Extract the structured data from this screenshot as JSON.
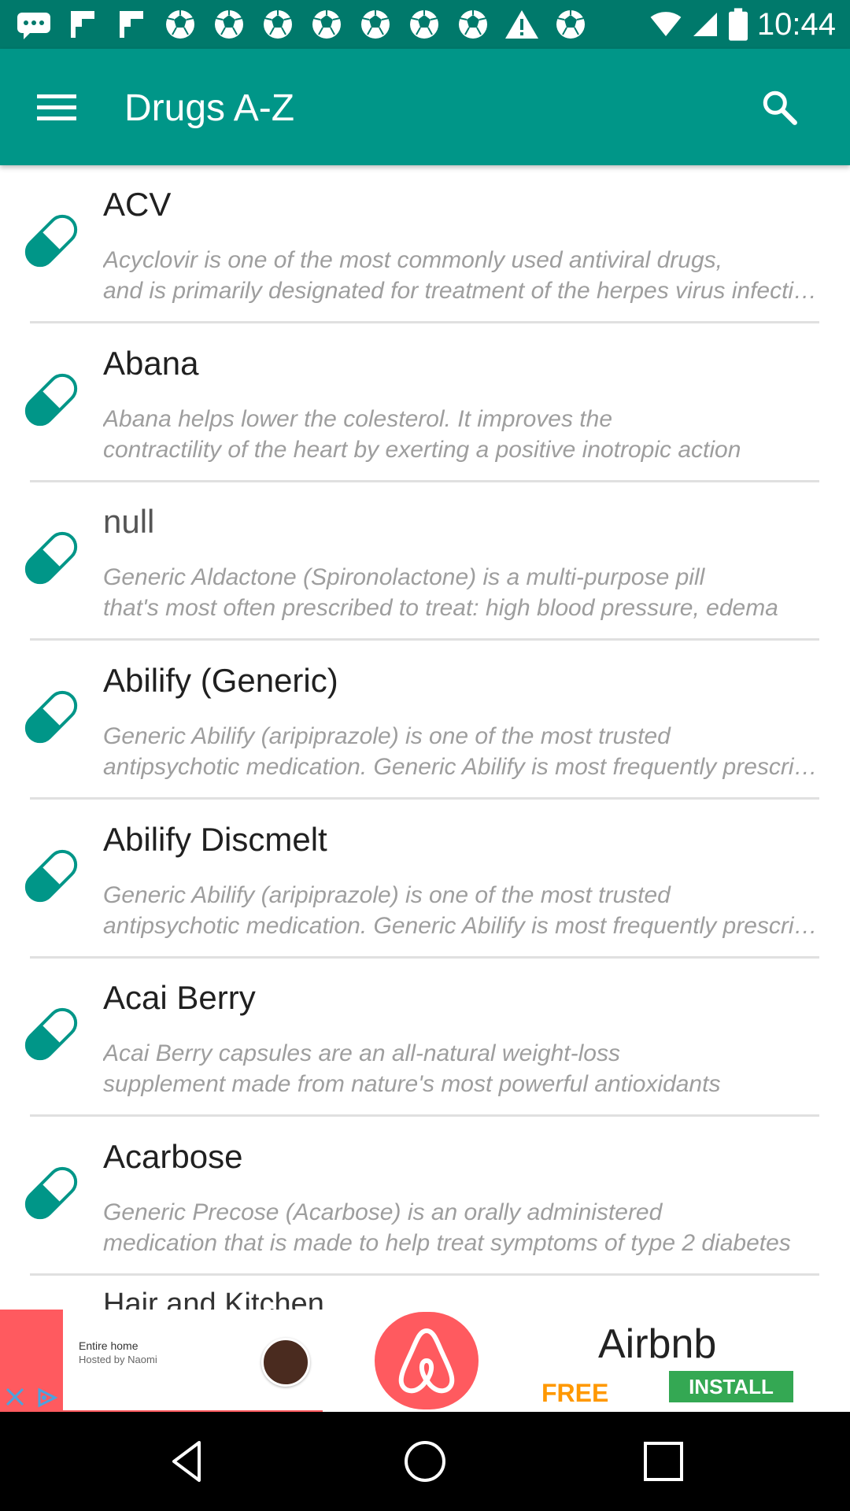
{
  "status_bar": {
    "time": "10:44",
    "notification_icons": [
      "chat-bubble-icon",
      "flipboard-icon",
      "flipboard-icon",
      "soccer-ball-icon",
      "soccer-ball-icon",
      "soccer-ball-icon",
      "soccer-ball-icon",
      "soccer-ball-icon",
      "soccer-ball-icon",
      "soccer-ball-icon",
      "warning-icon",
      "soccer-ball-icon"
    ]
  },
  "app_bar": {
    "title": "Drugs A-Z",
    "menu_icon": "hamburger-menu-icon",
    "search_icon": "search-icon",
    "color": "#009688"
  },
  "drugs": [
    {
      "name": "ACV",
      "desc_line1": "Acyclovir is one of the most commonly used antiviral drugs,",
      "desc_line2": "and is primarily designated for treatment of the herpes virus infections"
    },
    {
      "name": "Abana",
      "desc_line1": "Abana helps lower the colesterol. It improves the",
      "desc_line2": "contractility of the heart by exerting a positive inotropic action"
    },
    {
      "name": "null",
      "desc_line1": "Generic Aldactone (Spironolactone) is a multi-purpose pill",
      "desc_line2": "that's most often prescribed to treat: high blood pressure, edema"
    },
    {
      "name": "Abilify (Generic)",
      "desc_line1": "Generic Abilify (aripiprazole) is one of the most trusted",
      "desc_line2": "antipsychotic medication. Generic Abilify is most frequently prescribed"
    },
    {
      "name": "Abilify Discmelt",
      "desc_line1": "Generic Abilify (aripiprazole) is one of the most trusted",
      "desc_line2": "antipsychotic medication. Generic Abilify is most frequently prescribed"
    },
    {
      "name": "Acai Berry",
      "desc_line1": "Acai Berry capsules are an all-natural weight-loss",
      "desc_line2": "supplement made from nature's most powerful antioxidants"
    },
    {
      "name": "Acarbose",
      "desc_line1": "Generic Precose (Acarbose) is an orally administered",
      "desc_line2": "medication that is made to help treat symptoms of type 2 diabetes"
    }
  ],
  "partial_item": "Hair and Kitchen",
  "ad": {
    "card_line1": "Entire home",
    "card_line2": "Hosted by Naomi",
    "brand": "Airbnb",
    "free_label": "FREE",
    "install_label": "INSTALL"
  },
  "colors": {
    "primary": "#009688",
    "status_bar": "#00796b",
    "pill": "#009688",
    "ad_brand": "#ff5a5f"
  }
}
